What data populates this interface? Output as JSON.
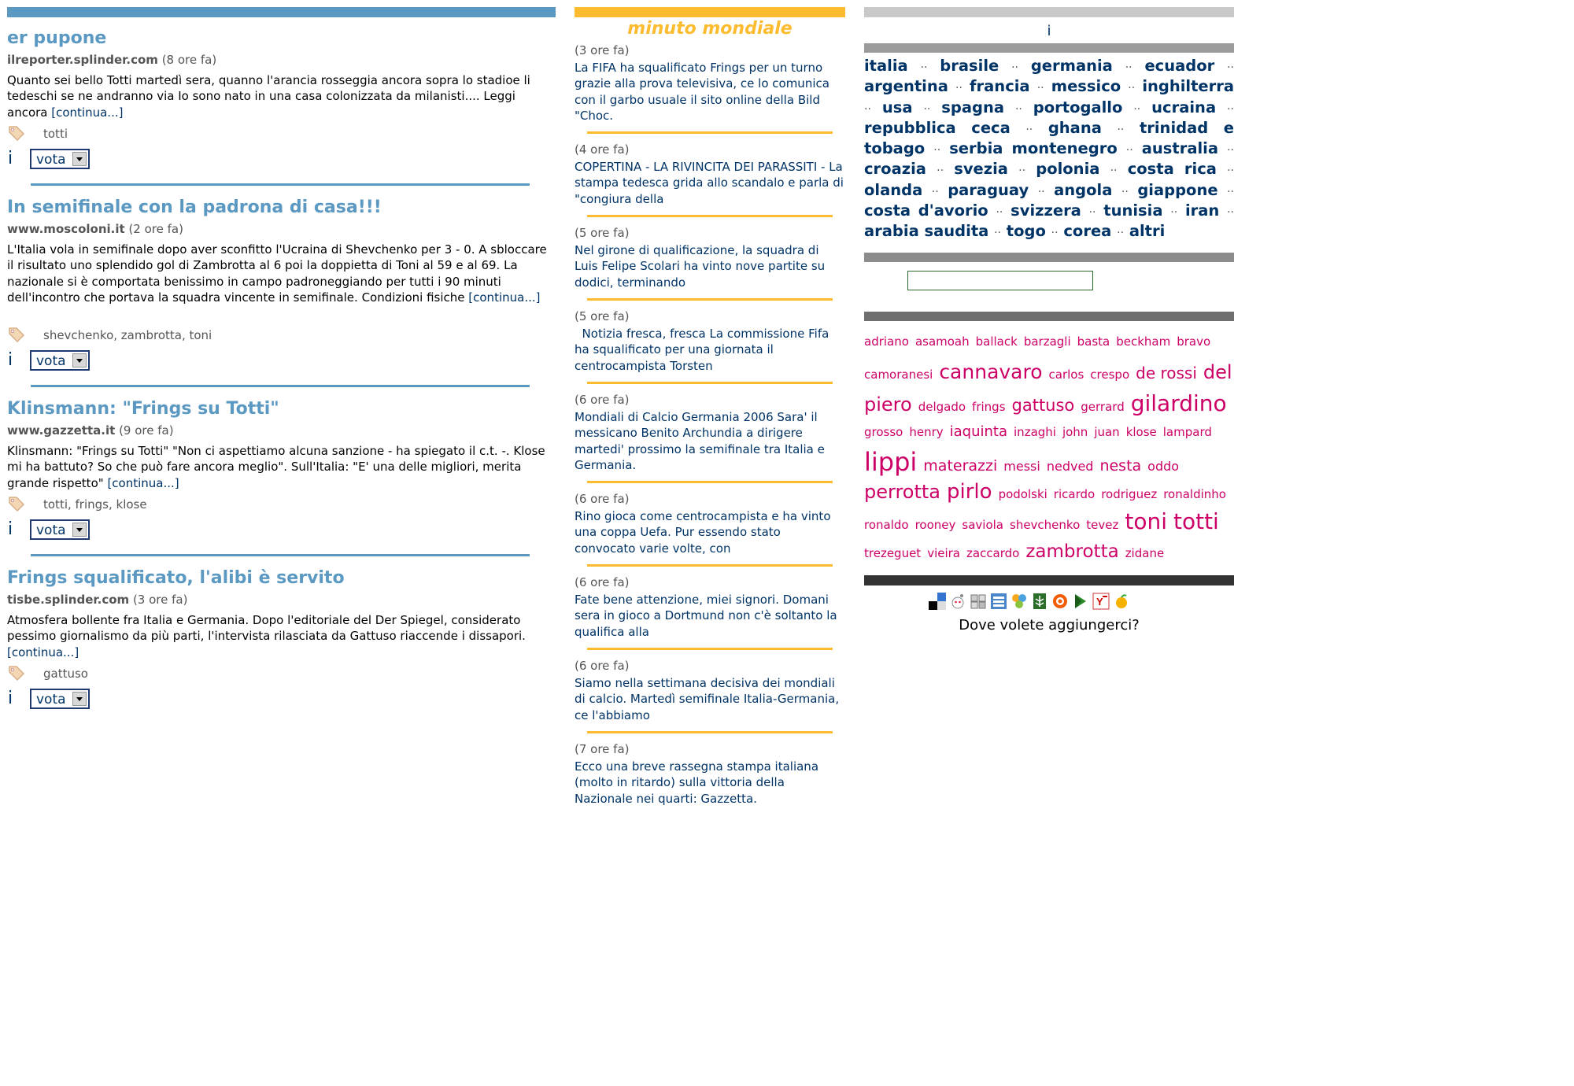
{
  "posts": [
    {
      "title": "er pupone",
      "source": "ilreporter.splinder.com",
      "time": "(8 ore fa)",
      "body": "Quanto sei bello Totti martedì sera, quanno l'arancia rosseggia ancora sopra lo stadioe li tedeschi se ne andranno via Io sono nato in una casa colonizzata da milanisti.... Leggi ancora",
      "more": "[continua...]",
      "tags": "totti",
      "vote_i": "i",
      "vote_label": "vota"
    },
    {
      "title": "In semifinale con la padrona di casa!!!",
      "source": "www.moscoloni.it",
      "time": "(2 ore fa)",
      "body": "L'Italia vola in semifinale dopo aver sconfitto l'Ucraina di Shevchenko per 3 - 0. A sbloccare il risultato uno splendido gol di Zambrotta al 6 poi la doppietta di Toni al 59 e al 69. La nazionale si è comportata benissimo in campo padroneggiando per tutti i 90 minuti dell'incontro che portava la squadra vincente in semifinale. Condizioni fisiche",
      "more": "[continua...]",
      "tags": "shevchenko,  zambrotta,  toni",
      "vote_i": "i",
      "vote_label": "vota"
    },
    {
      "title": "Klinsmann: \"Frings su Totti\"",
      "source": "www.gazzetta.it",
      "time": "(9 ore fa)",
      "body": "Klinsmann: \"Frings su Totti\" \"Non ci aspettiamo alcuna sanzione - ha spiegato il c.t. -. Klose mi ha battuto? So che può fare ancora meglio\". Sull'Italia: \"E' una delle migliori, merita grande rispetto\"",
      "more": "[continua...]",
      "tags": "totti,  frings,  klose",
      "vote_i": "i",
      "vote_label": "vota"
    },
    {
      "title": "Frings squalificato, l'alibi è servito",
      "source": "tisbe.splinder.com",
      "time": "(3 ore fa)",
      "body": "Atmosfera bollente fra Italia e Germania. Dopo l'editoriale del Der Spiegel, considerato pessimo giornalismo da più parti, l'intervista rilasciata da Gattuso riaccende i dissapori.",
      "more": "[continua...]",
      "tags": "gattuso",
      "vote_i": "i",
      "vote_label": "vota"
    }
  ],
  "middle": {
    "title": "minuto mondiale",
    "items": [
      {
        "time": "(3 ore fa)",
        "text": "La FIFA ha squalificato Frings per un turno grazie alla prova televisiva, ce lo comunica con il garbo usuale il sito online della Bild \"Choc."
      },
      {
        "time": "(4 ore fa)",
        "text": "COPERTINA - LA RIVINCITA DEI PARASSITI - La stampa tedesca grida allo scandalo e parla di \"congiura della"
      },
      {
        "time": "(5 ore fa)",
        "text": "Nel girone di qualificazione, la squadra di Luis Felipe Scolari ha vinto nove partite su dodici, terminando"
      },
      {
        "time": "(5 ore fa)",
        "text": "  Notizia fresca, fresca La commissione Fifa ha squalificato per una giornata il centrocampista Torsten"
      },
      {
        "time": "(6 ore fa)",
        "text": "Mondiali di Calcio Germania 2006 Sara' il messicano Benito Archundia a dirigere martedi' prossimo la semifinale tra Italia e Germania."
      },
      {
        "time": "(6 ore fa)",
        "text": "Rino gioca come centrocampista e ha vinto una coppa Uefa. Pur essendo stato convocato varie volte, con"
      },
      {
        "time": "(6 ore fa)",
        "text": "Fate bene attenzione, miei signori. Domani sera in gioco a Dortmund non c'è soltanto la qualifica alla"
      },
      {
        "time": "(6 ore fa)",
        "text": "Siamo nella settimana decisiva dei mondiali di calcio. Martedì semifinale Italia-Germania, ce l'abbiamo"
      },
      {
        "time": "(7 ore fa)",
        "text": "Ecco una breve rassegna stampa italiana (molto in ritardo) sulla vittoria della Nazionale nei quarti: Gazzetta."
      }
    ]
  },
  "right": {
    "info_i": "i",
    "separator": "··",
    "countries": [
      "italia",
      "brasile",
      "germania",
      "ecuador",
      "argentina",
      "francia",
      "messico",
      "inghilterra",
      "usa",
      "spagna",
      "portogallo",
      "ucraina",
      "repubblica ceca",
      "ghana",
      "trinidad e tobago",
      "serbia montenegro",
      "australia",
      "croazia",
      "svezia",
      "polonia",
      "costa rica",
      "olanda",
      "paraguay",
      "angola",
      "giappone",
      "costa d'avorio",
      "svizzera",
      "tunisia",
      "iran",
      "arabia saudita",
      "togo",
      "corea",
      "altri"
    ],
    "search_value": "",
    "tag_color": "#cc0066",
    "tag_cloud": [
      [
        [
          "adriano",
          15
        ],
        [
          "asamoah",
          15
        ],
        [
          "ballack",
          15
        ],
        [
          "barzagli",
          15
        ],
        [
          "basta",
          15
        ],
        [
          "beckham",
          15
        ],
        [
          "bravo",
          15
        ]
      ],
      [
        [
          "camoranesi",
          15
        ],
        [
          "cannavaro",
          25
        ],
        [
          "carlos",
          15
        ],
        [
          "crespo",
          15
        ],
        [
          "de rossi",
          20
        ],
        [
          "del",
          24
        ]
      ],
      [
        [
          "piero",
          24
        ],
        [
          "delgado",
          15
        ],
        [
          "frings",
          15
        ],
        [
          "gattuso",
          21
        ],
        [
          "gerrard",
          15
        ],
        [
          "gilardino",
          28
        ]
      ],
      [
        [
          "grosso",
          15
        ],
        [
          "henry",
          15
        ],
        [
          "iaquinta",
          18
        ],
        [
          "inzaghi",
          15
        ],
        [
          "john",
          15
        ],
        [
          "juan",
          15
        ],
        [
          "klose",
          15
        ],
        [
          "lampard",
          15
        ]
      ],
      [
        [
          "lippi",
          32
        ],
        [
          "materazzi",
          19
        ],
        [
          "messi",
          16
        ],
        [
          "nedved",
          16
        ],
        [
          "nesta",
          19
        ],
        [
          "oddo",
          16
        ]
      ],
      [
        [
          "perrotta",
          24
        ],
        [
          "pirlo",
          26
        ],
        [
          "podolski",
          15
        ],
        [
          "ricardo",
          15
        ],
        [
          "rodriguez",
          15
        ],
        [
          "ronaldinho",
          15
        ]
      ],
      [
        [
          "ronaldo",
          15
        ],
        [
          "rooney",
          15
        ],
        [
          "saviola",
          15
        ],
        [
          "shevchenko",
          15
        ],
        [
          "tevez",
          15
        ],
        [
          "toni",
          28
        ],
        [
          "totti",
          28
        ]
      ],
      [
        [
          "trezeguet",
          15
        ],
        [
          "vieira",
          15
        ],
        [
          "zaccardo",
          15
        ],
        [
          "zambrotta",
          23
        ],
        [
          "zidane",
          15
        ]
      ]
    ],
    "bookmark_icons": [
      "delicious-icon",
      "digg-icon",
      "furl-icon",
      "blinklist-icon",
      "spurl-icon",
      "blogmarks-icon",
      "technorati-icon",
      "stumbleupon-icon",
      "yahoo-icon",
      "ma-gnolia-icon"
    ],
    "add_text": "Dove volete aggiungerci?"
  }
}
